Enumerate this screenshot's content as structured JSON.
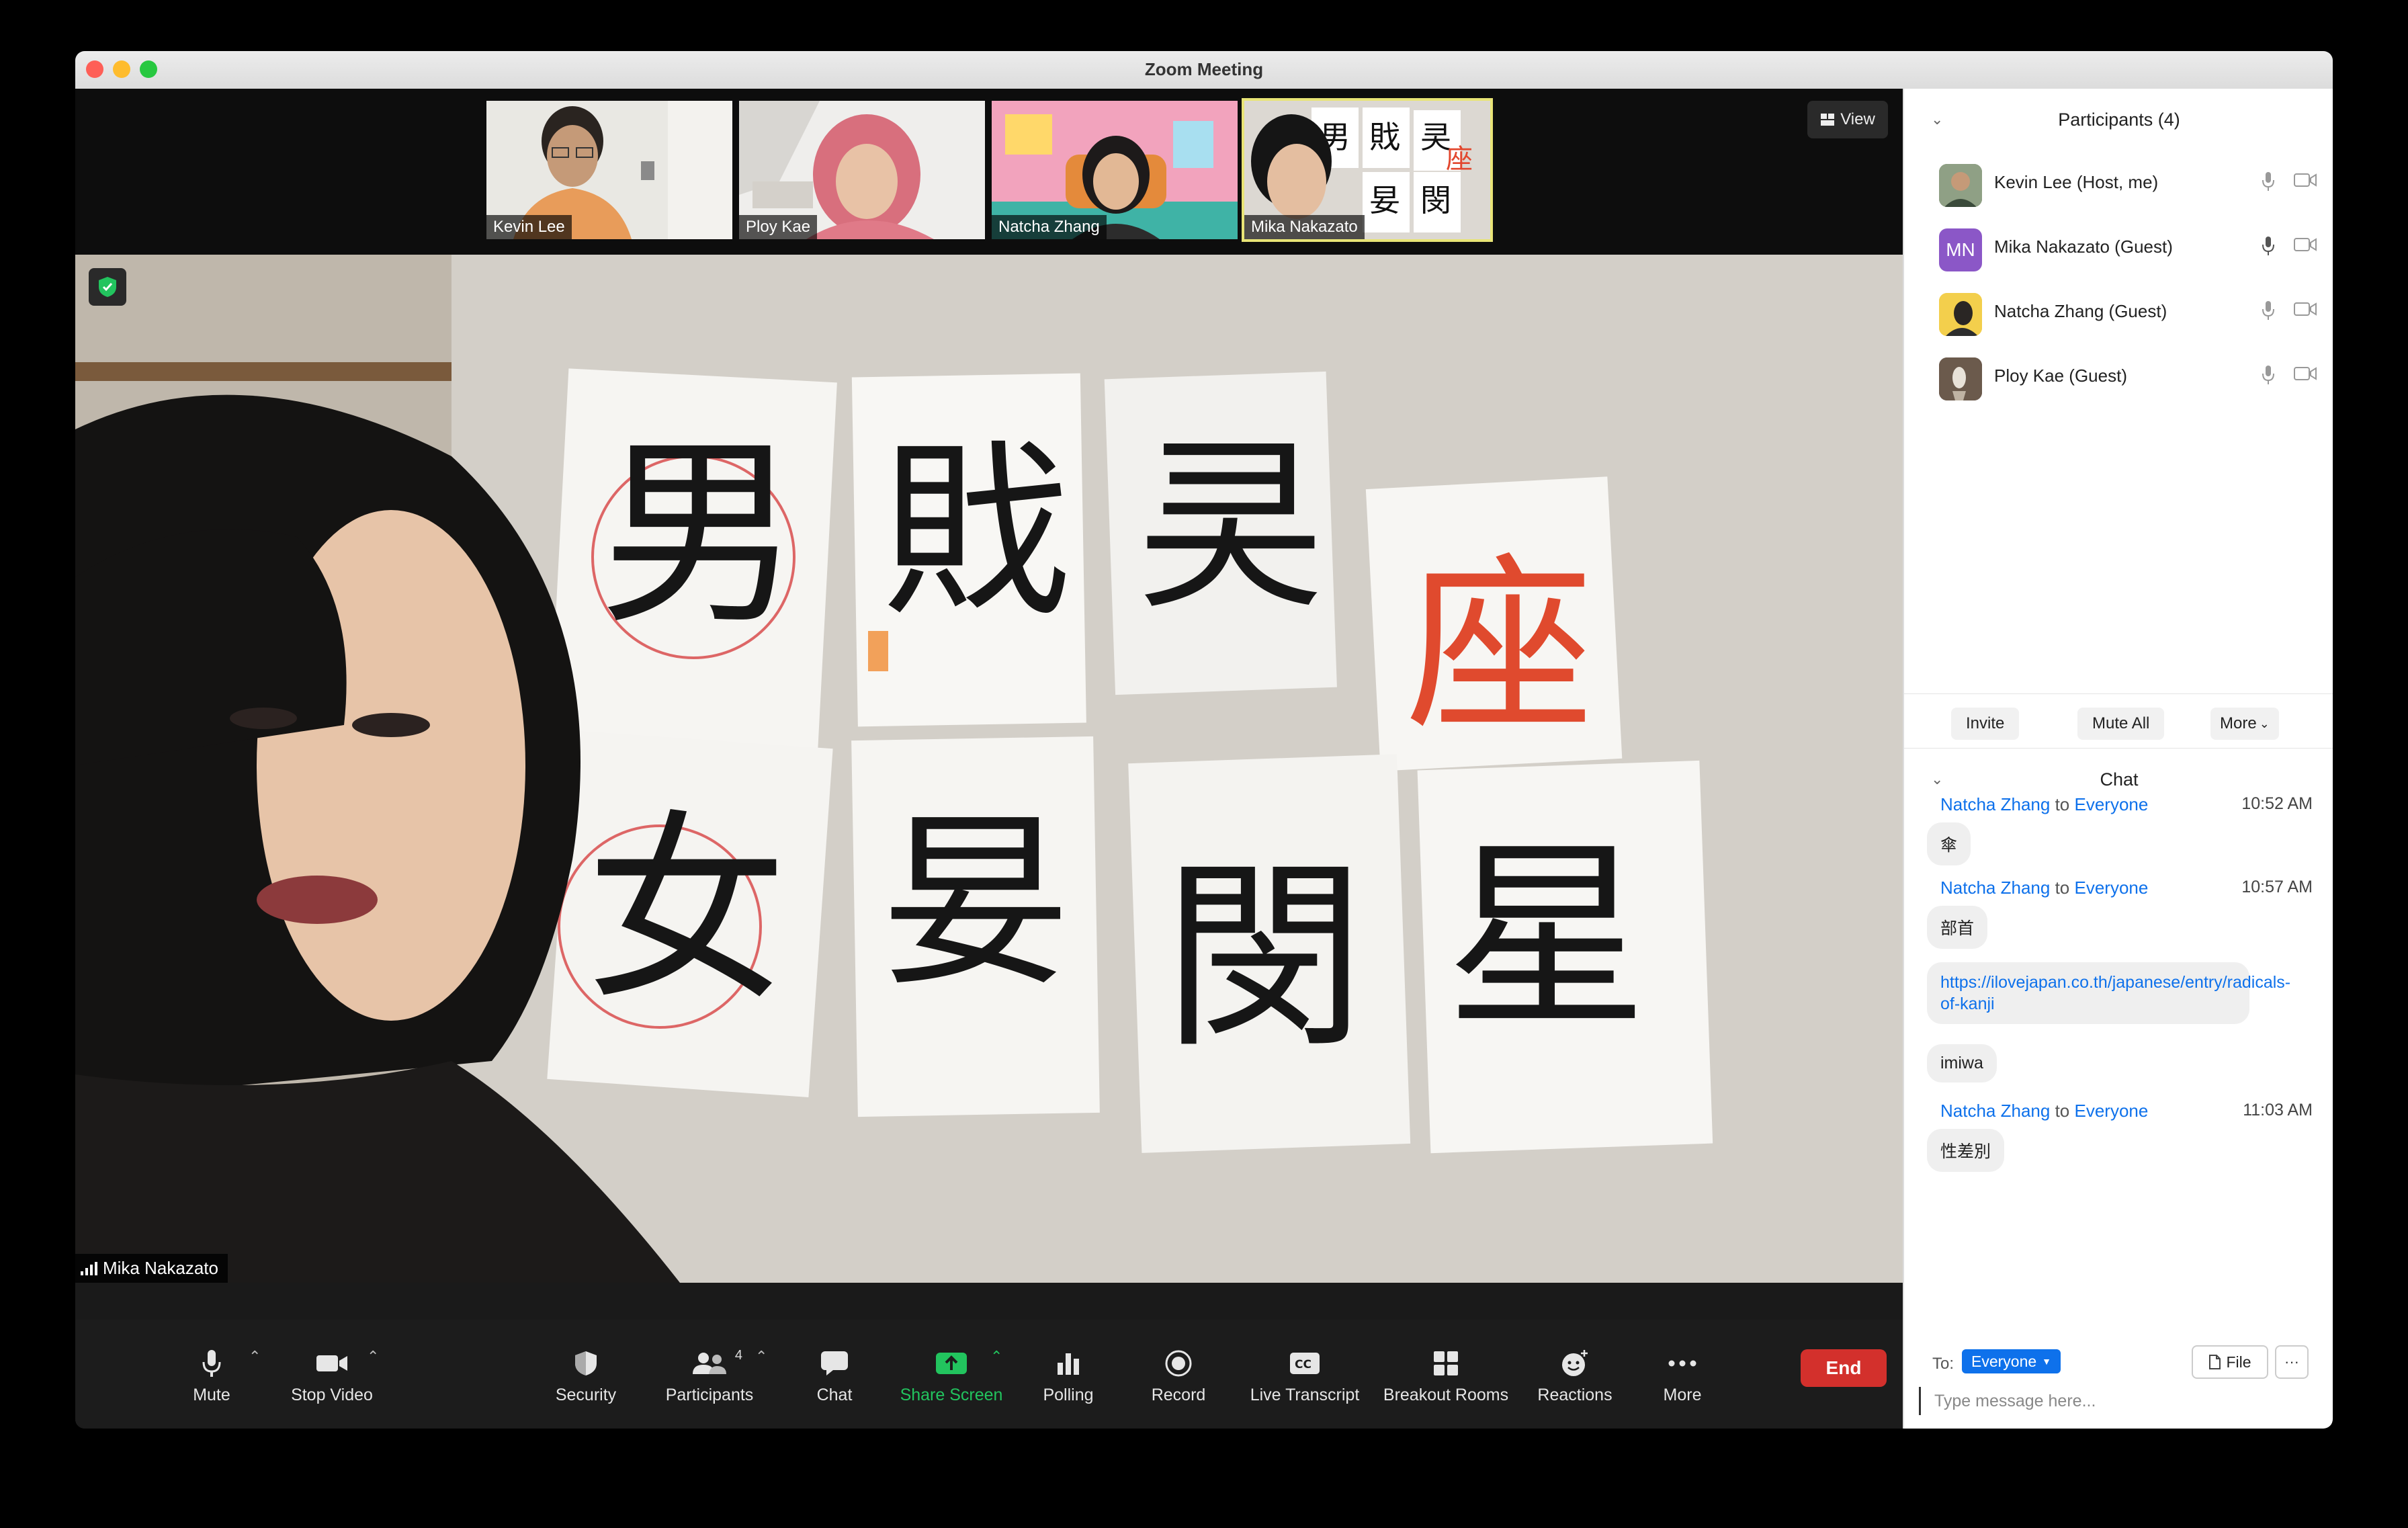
{
  "window": {
    "title": "Zoom Meeting"
  },
  "thumbnails": [
    {
      "name": "Kevin Lee"
    },
    {
      "name": "Ploy Kae"
    },
    {
      "name": "Natcha Zhang"
    },
    {
      "name": "Mika Nakazato"
    }
  ],
  "view_button": {
    "label": "View"
  },
  "main_video": {
    "speaker": "Mika Nakazato",
    "kanji_cards": [
      "男",
      "戝",
      "㚑",
      "女",
      "妟",
      "閔",
      "星",
      "座"
    ]
  },
  "toolbar": {
    "mute": "Mute",
    "stop_video": "Stop Video",
    "security": "Security",
    "participants": "Participants",
    "participants_count": "4",
    "chat": "Chat",
    "share_screen": "Share Screen",
    "polling": "Polling",
    "record": "Record",
    "live_transcript": "Live Transcript",
    "breakout_rooms": "Breakout Rooms",
    "reactions": "Reactions",
    "more": "More",
    "end": "End"
  },
  "participants_panel": {
    "title": "Participants (4)",
    "list": [
      {
        "name": "Kevin Lee (Host, me)"
      },
      {
        "name": "Mika Nakazato (Guest)",
        "initials": "MN"
      },
      {
        "name": "Natcha Zhang (Guest)"
      },
      {
        "name": "Ploy Kae (Guest)"
      }
    ],
    "invite": "Invite",
    "mute_all": "Mute All",
    "more": "More"
  },
  "chat_panel": {
    "title": "Chat",
    "messages": [
      {
        "from": "Natcha Zhang",
        "to_word": "to",
        "to": "Everyone",
        "time": "10:52 AM",
        "text": "傘"
      },
      {
        "from": "Natcha Zhang",
        "to_word": "to",
        "to": "Everyone",
        "time": "10:57 AM",
        "text": "部首"
      },
      {
        "text": "https://ilovejapan.co.th/japanese/entry/radicals-of-kanji"
      },
      {
        "text": "imiwa"
      },
      {
        "from": "Natcha Zhang",
        "to_word": "to",
        "to": "Everyone",
        "time": "11:03 AM",
        "text": "性差別"
      }
    ],
    "to_label": "To:",
    "to_value": "Everyone",
    "file": "File",
    "placeholder": "Type message here..."
  },
  "colors": {
    "accent_blue": "#0e71eb",
    "end_red": "#d3302c",
    "share_green": "#22c45e",
    "active_thumb": "#e8e476"
  }
}
